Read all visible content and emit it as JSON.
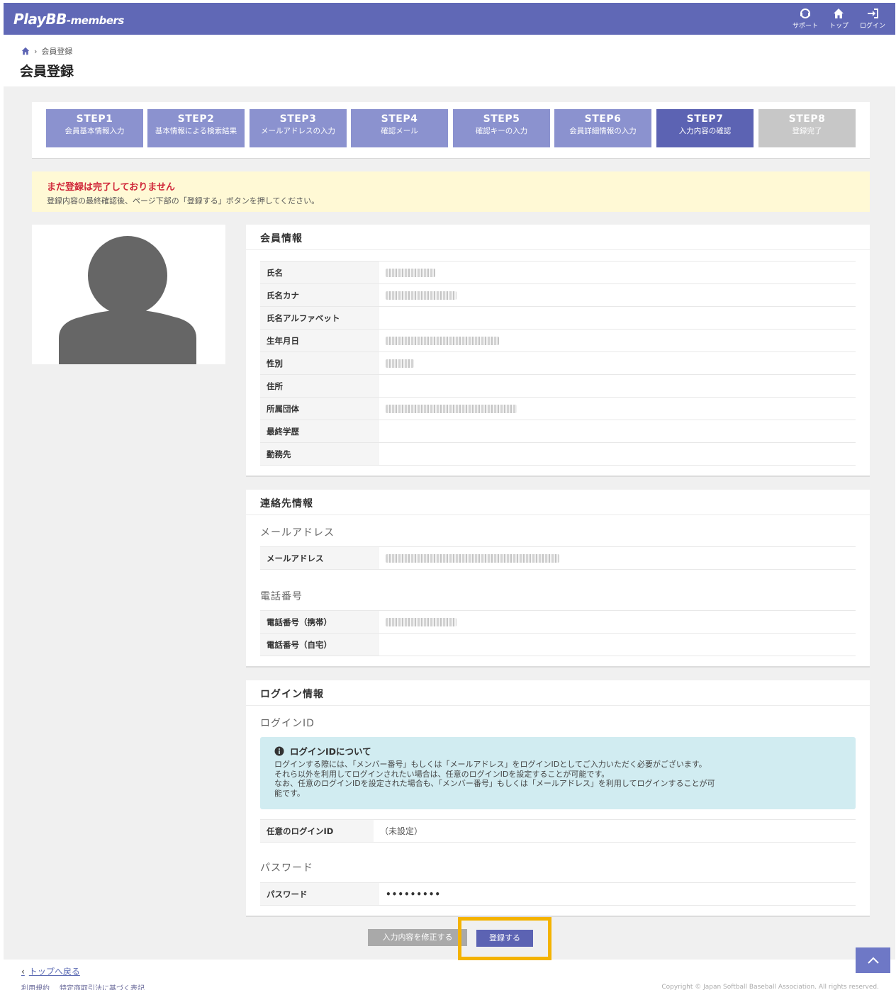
{
  "header": {
    "logo_main": "PlayBB",
    "logo_sub": "-members",
    "nav": [
      {
        "label": "サポート",
        "icon": "support-icon"
      },
      {
        "label": "トップ",
        "icon": "home-icon"
      },
      {
        "label": "ログイン",
        "icon": "login-icon"
      }
    ]
  },
  "breadcrumb": {
    "current": "会員登録"
  },
  "page_title": "会員登録",
  "steps": [
    {
      "title": "STEP1",
      "desc": "会員基本情報入力"
    },
    {
      "title": "STEP2",
      "desc": "基本情報による検索結果"
    },
    {
      "title": "STEP3",
      "desc": "メールアドレスの入力"
    },
    {
      "title": "STEP4",
      "desc": "確認メール"
    },
    {
      "title": "STEP5",
      "desc": "確認キーの入力"
    },
    {
      "title": "STEP6",
      "desc": "会員詳細情報の入力"
    },
    {
      "title": "STEP7",
      "desc": "入力内容の確認"
    },
    {
      "title": "STEP8",
      "desc": "登録完了"
    }
  ],
  "notice": {
    "title": "まだ登録は完了しておりません",
    "body": "登録内容の最終確認後、ページ下部の「登録する」ボタンを押してください。"
  },
  "member_info": {
    "title": "会員情報",
    "rows": [
      {
        "label": "氏名"
      },
      {
        "label": "氏名カナ"
      },
      {
        "label": "氏名アルファベット"
      },
      {
        "label": "生年月日"
      },
      {
        "label": "性別"
      },
      {
        "label": "住所"
      },
      {
        "label": "所属団体"
      },
      {
        "label": "最終学歴"
      },
      {
        "label": "勤務先"
      }
    ]
  },
  "contact_info": {
    "title": "連絡先情報",
    "email_section": "メールアドレス",
    "email_label": "メールアドレス",
    "phone_section": "電話番号",
    "mobile_label": "電話番号（携帯）",
    "home_label": "電話番号（自宅）"
  },
  "login_info": {
    "title": "ログイン情報",
    "id_section": "ログインID",
    "info_title": "ログインIDについて",
    "info_lines": [
      "ログインする際には、「メンバー番号」もしくは「メールアドレス」をログインIDとしてご入力いただく必要がございます。",
      "それら以外を利用してログインされたい場合は、任意のログインIDを設定することが可能です。",
      "なお、任意のログインIDを設定された場合も、「メンバー番号」もしくは「メールアドレス」を利用してログインすることが可",
      "能です。"
    ],
    "custom_id_label": "任意のログインID",
    "custom_id_value": "（未設定）",
    "password_section": "パスワード",
    "password_label": "パスワード",
    "password_value": "•••••••••"
  },
  "buttons": {
    "back": "入力内容を修正する",
    "submit": "登録する"
  },
  "footer": {
    "back_top": "トップへ戻る",
    "links": [
      "利用規約",
      "特定商取引法に基づく表記"
    ],
    "copyright": "Copyright © Japan Softball Baseball Association. All rights reserved."
  },
  "colors": {
    "header": "#6068b6",
    "step": "#8b92cf",
    "step_current": "#5c63b3",
    "alert": "#d0283a",
    "notice_bg": "#fff9d5",
    "info_bg": "#d1ecf1",
    "highlight": "#f4b300"
  }
}
